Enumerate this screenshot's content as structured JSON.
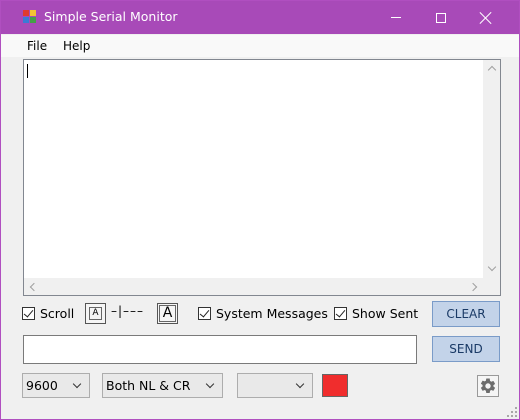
{
  "window": {
    "title": "Simple Serial Monitor"
  },
  "menu": {
    "items": [
      "File",
      "Help"
    ]
  },
  "output": {
    "text": ""
  },
  "controls": {
    "scroll_label": "Scroll",
    "scroll_checked": true,
    "font_small_glyph": "A",
    "font_large_glyph": "A",
    "font_slider_text": "–|–––",
    "system_messages_label": "System Messages",
    "system_messages_checked": true,
    "show_sent_label": "Show Sent",
    "show_sent_checked": true,
    "clear_label": "CLEAR",
    "send_label": "SEND"
  },
  "send_input": {
    "value": ""
  },
  "bottom": {
    "baud_rate": "9600",
    "line_ending": "Both NL & CR",
    "port": "",
    "status_color": "#f02d2d"
  },
  "icons": {
    "app": "app-icon",
    "minimize": "minimize-icon",
    "maximize": "maximize-icon",
    "close": "close-icon",
    "settings": "gear-icon"
  },
  "colors": {
    "titlebar": "#a84ab8",
    "button": "#c3d3e9"
  }
}
